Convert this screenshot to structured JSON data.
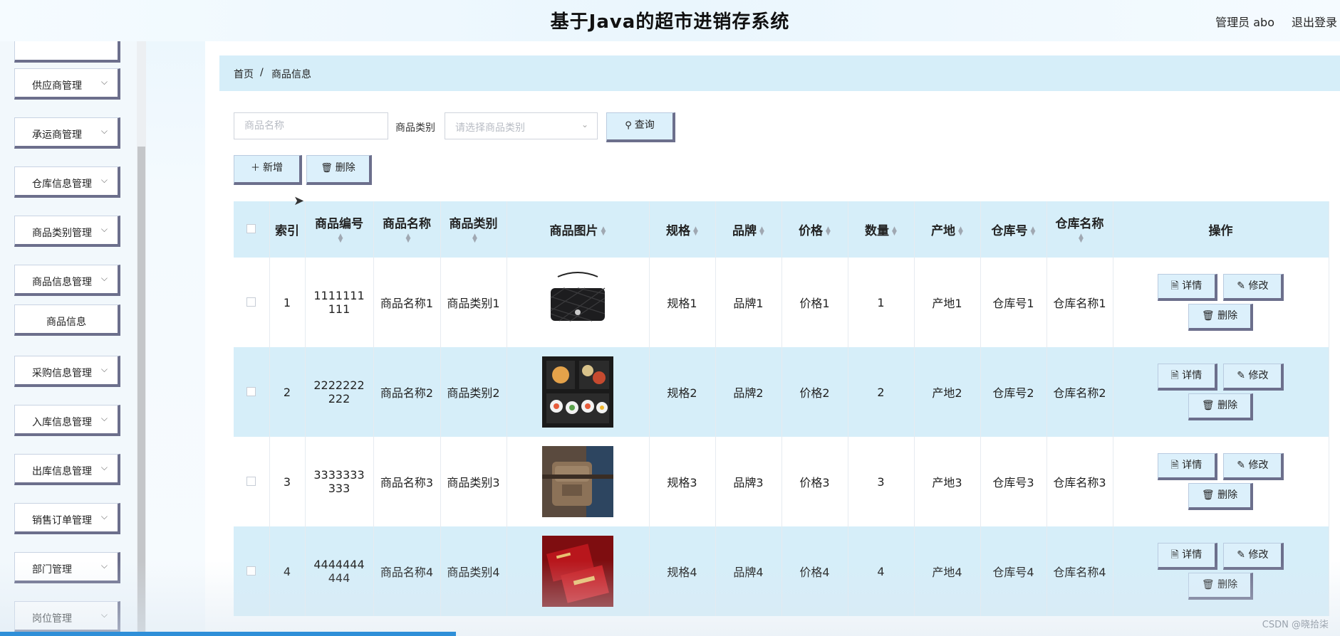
{
  "header": {
    "title": "基于Java的超市进销存系统",
    "user": "管理员 abo",
    "logout": "退出登录"
  },
  "sidebar": {
    "items": [
      {
        "label": "",
        "has_chevron": false
      },
      {
        "label": "供应商管理",
        "has_chevron": true
      },
      {
        "label": "承运商管理",
        "has_chevron": true
      },
      {
        "label": "仓库信息管理",
        "has_chevron": true
      },
      {
        "label": "商品类别管理",
        "has_chevron": true
      },
      {
        "label": "商品信息管理",
        "has_chevron": true
      },
      {
        "label": "商品信息",
        "has_chevron": false
      },
      {
        "label": "采购信息管理",
        "has_chevron": true
      },
      {
        "label": "入库信息管理",
        "has_chevron": true
      },
      {
        "label": "出库信息管理",
        "has_chevron": true
      },
      {
        "label": "销售订单管理",
        "has_chevron": true
      },
      {
        "label": "部门管理",
        "has_chevron": true
      },
      {
        "label": "岗位管理",
        "has_chevron": true
      }
    ]
  },
  "breadcrumb": {
    "home": "首页",
    "separator": "/",
    "current": "商品信息"
  },
  "search": {
    "name_placeholder": "商品名称",
    "category_label": "商品类别",
    "category_placeholder": "请选择商品类别",
    "query_button": "查询"
  },
  "toolbar": {
    "add": "新增",
    "delete": "删除"
  },
  "table": {
    "headers": {
      "index": "索引",
      "code": "商品编号",
      "name": "商品名称",
      "category": "商品类别",
      "image": "商品图片",
      "spec": "规格",
      "brand": "品牌",
      "price": "价格",
      "qty": "数量",
      "origin": "产地",
      "wh_no": "仓库号",
      "wh_name": "仓库名称",
      "ops": "操作"
    },
    "rows": [
      {
        "index": "1",
        "code": "1111111111",
        "name": "商品名称1",
        "category": "商品类别1",
        "image": "handbag",
        "spec": "规格1",
        "brand": "品牌1",
        "price": "价格1",
        "qty": "1",
        "origin": "产地1",
        "wh_no": "仓库号1",
        "wh_name": "仓库名称1"
      },
      {
        "index": "2",
        "code": "2222222222",
        "name": "商品名称2",
        "category": "商品类别2",
        "image": "bento",
        "spec": "规格2",
        "brand": "品牌2",
        "price": "价格2",
        "qty": "2",
        "origin": "产地2",
        "wh_no": "仓库号2",
        "wh_name": "仓库名称2"
      },
      {
        "index": "3",
        "code": "3333333333",
        "name": "商品名称3",
        "category": "商品类别3",
        "image": "waist-bag",
        "spec": "规格3",
        "brand": "品牌3",
        "price": "价格3",
        "qty": "3",
        "origin": "产地3",
        "wh_no": "仓库号3",
        "wh_name": "仓库名称3"
      },
      {
        "index": "4",
        "code": "4444444444",
        "name": "商品名称4",
        "category": "商品类别4",
        "image": "red-gift",
        "spec": "规格4",
        "brand": "品牌4",
        "price": "价格4",
        "qty": "4",
        "origin": "产地4",
        "wh_no": "仓库号4",
        "wh_name": "仓库名称4"
      }
    ],
    "ops": {
      "detail": "详情",
      "edit": "修改",
      "delete": "删除"
    }
  },
  "watermark": "CSDN @晓拾柒",
  "colors": {
    "accent_light": "#d6eef9",
    "button_shadow": "#6c6f8c",
    "progress": "#2f8fd8"
  }
}
